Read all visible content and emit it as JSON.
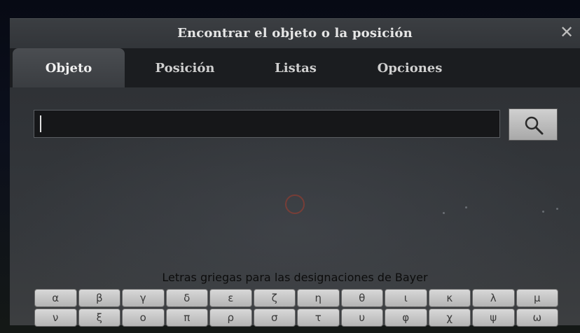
{
  "dialog": {
    "title": "Encontrar el objeto o la posición",
    "close_label": "✕"
  },
  "tabs": [
    {
      "label": "Objeto",
      "active": true
    },
    {
      "label": "Posición",
      "active": false
    },
    {
      "label": "Listas",
      "active": false
    },
    {
      "label": "Opciones",
      "active": false
    }
  ],
  "search": {
    "value": "",
    "button_icon": "search-icon"
  },
  "greek": {
    "label": "Letras griegas para las designaciones de Bayer",
    "letters": [
      "α",
      "β",
      "γ",
      "δ",
      "ε",
      "ζ",
      "η",
      "θ",
      "ι",
      "κ",
      "λ",
      "μ",
      "ν",
      "ξ",
      "ο",
      "π",
      "ρ",
      "σ",
      "τ",
      "υ",
      "φ",
      "χ",
      "ψ",
      "ω"
    ]
  }
}
